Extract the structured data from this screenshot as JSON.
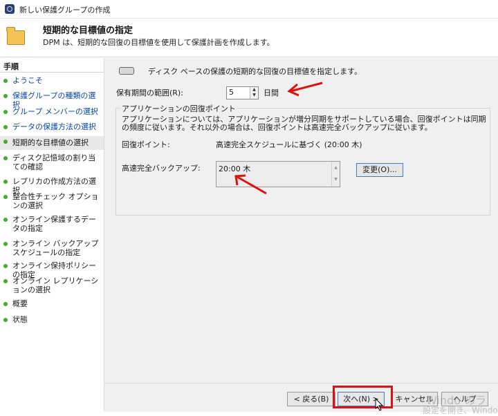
{
  "window": {
    "title": "新しい保護グループの作成"
  },
  "header": {
    "title": "短期的な目標値の指定",
    "subtitle": "DPM は、短期的な回復の目標値を使用して保護計画を作成します。"
  },
  "sidebar": {
    "heading": "手順",
    "steps": [
      {
        "label": "ようこそ"
      },
      {
        "label": "保護グループの種類の選択"
      },
      {
        "label": "グループ メンバーの選択"
      },
      {
        "label": "データの保護方法の選択"
      },
      {
        "label": "短期的な目標値の選択"
      },
      {
        "label": "ディスク記憶域の割り当ての確認"
      },
      {
        "label": "レプリカの作成方法の選択"
      },
      {
        "label": "整合性チェック オプションの選択"
      },
      {
        "label": "オンライン保護するデータの指定"
      },
      {
        "label": "オンライン バックアップ スケジュールの指定"
      },
      {
        "label": "オンライン保持ポリシーの指定"
      },
      {
        "label": "オンライン レプリケーションの選択"
      },
      {
        "label": "概要"
      },
      {
        "label": "状態"
      }
    ]
  },
  "main": {
    "description": "ディスク ベースの保護の短期的な回復の目標値を指定します。",
    "retention": {
      "label": "保有期間の範囲(R):",
      "value": "5",
      "unit": "日間"
    },
    "recovery": {
      "group_title": "アプリケーションの回復ポイント",
      "explanation": "アプリケーションについては、アプリケーションが増分同期をサポートしている場合、回復ポイントは同期の頻度に従います。それ以外の場合は、回復ポイントは高速完全バックアップに従います。",
      "recovery_points_label": "回復ポイント:",
      "recovery_points_value": "高速完全スケジュールに基づく (20:00 木)",
      "full_backup_label": "高速完全バックアップ:",
      "full_backup_value": "20:00 木",
      "change_button": "変更(O)..."
    }
  },
  "footer": {
    "back": "< 戻る(B)",
    "next": "次へ(N) >",
    "cancel": "キャンセル",
    "help": "ヘルプ"
  },
  "watermark": {
    "line1": "Windo のラ",
    "line2": "設定を開き、Windo"
  },
  "colors": {
    "accent_red": "#e01010",
    "step_green": "#3fae2a",
    "link_blue": "#0645ad"
  }
}
